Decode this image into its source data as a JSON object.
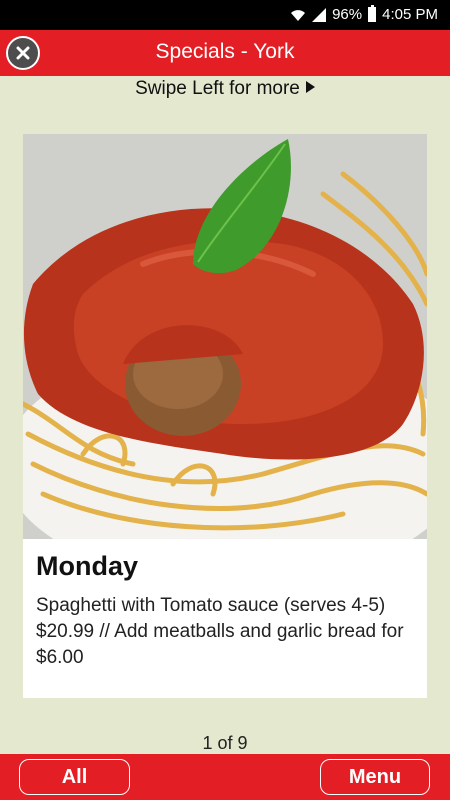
{
  "status_bar": {
    "battery": "96%",
    "time": "4:05 PM"
  },
  "header": {
    "title": "Specials - York",
    "close_icon": "close-icon"
  },
  "swipe_hint": "Swipe Left for more",
  "special": {
    "day": "Monday",
    "description": "Spaghetti with Tomato sauce (serves 4-5) $20.99 // Add meatballs and garlic bread for $6.00"
  },
  "pager": "1 of 9",
  "bottom_bar": {
    "all_label": "All",
    "menu_label": "Menu"
  },
  "colors": {
    "accent": "#e31e24",
    "background": "#e3e8cf"
  }
}
